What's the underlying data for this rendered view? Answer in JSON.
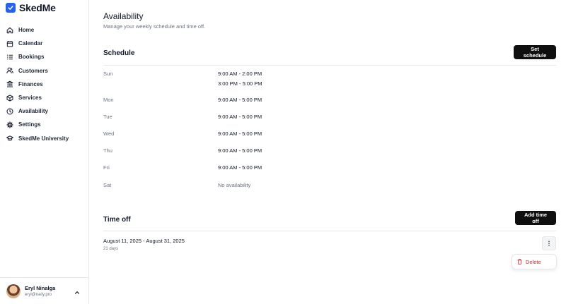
{
  "brand": {
    "name": "SkedMe",
    "color": "#2563eb"
  },
  "sidebar": {
    "items": [
      {
        "label": "Home",
        "icon": "home-icon"
      },
      {
        "label": "Calendar",
        "icon": "calendar-icon"
      },
      {
        "label": "Bookings",
        "icon": "list-icon"
      },
      {
        "label": "Customers",
        "icon": "users-icon"
      },
      {
        "label": "Finances",
        "icon": "bank-icon"
      },
      {
        "label": "Services",
        "icon": "box-icon"
      },
      {
        "label": "Availability",
        "icon": "clock-icon"
      },
      {
        "label": "Settings",
        "icon": "gear-icon"
      },
      {
        "label": "SkedMe University",
        "icon": "graduation-cap-icon"
      }
    ]
  },
  "user": {
    "name": "Eryl Ninalga",
    "email": "eryl@naily.pro"
  },
  "page": {
    "title": "Availability",
    "subtitle": "Manage your weekly schedule and time off."
  },
  "schedule": {
    "title": "Schedule",
    "button_label": "Set schedule",
    "days": [
      {
        "day": "Sun",
        "slots": [
          "9:00 AM - 2:00 PM",
          "3:00 PM - 5:00 PM"
        ]
      },
      {
        "day": "Mon",
        "slots": [
          "9:00 AM - 5:00 PM"
        ]
      },
      {
        "day": "Tue",
        "slots": [
          "9:00 AM - 5:00 PM"
        ]
      },
      {
        "day": "Wed",
        "slots": [
          "9:00 AM - 5:00 PM"
        ]
      },
      {
        "day": "Thu",
        "slots": [
          "9:00 AM - 5:00 PM"
        ]
      },
      {
        "day": "Fri",
        "slots": [
          "9:00 AM - 5:00 PM"
        ]
      },
      {
        "day": "Sat",
        "slots": [
          "No availability"
        ]
      }
    ]
  },
  "time_off": {
    "title": "Time off",
    "button_label": "Add time off",
    "entry": {
      "range": "August 11, 2025 - August 31, 2025",
      "duration": "21 days"
    },
    "menu": {
      "delete_label": "Delete",
      "delete_color": "#dc2626"
    }
  }
}
